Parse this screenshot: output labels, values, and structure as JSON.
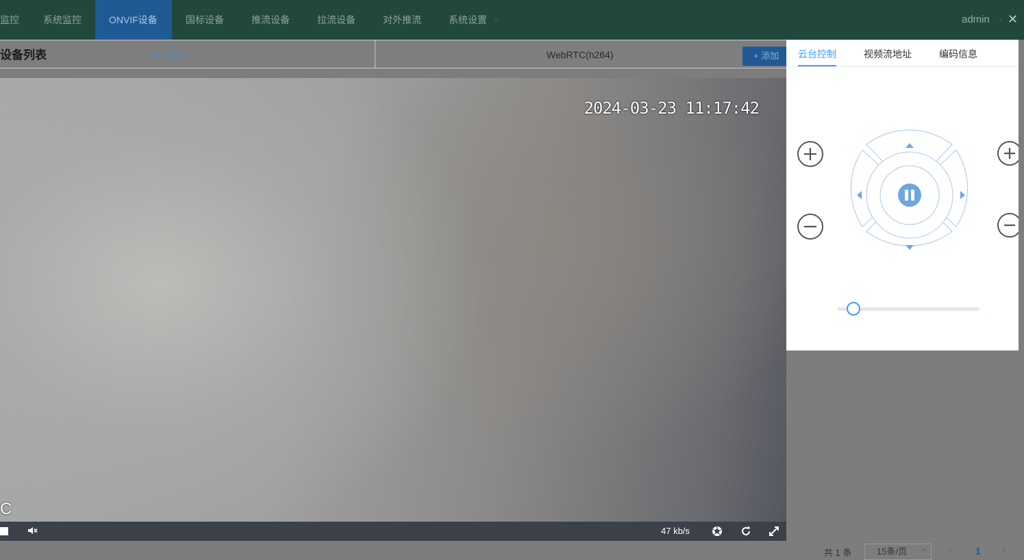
{
  "nav": {
    "items": [
      {
        "label": "监控"
      },
      {
        "label": "系统监控"
      },
      {
        "label": "ONVIF设备"
      },
      {
        "label": "国标设备"
      },
      {
        "label": "推流设备"
      },
      {
        "label": "拉流设备"
      },
      {
        "label": "对外推流"
      },
      {
        "label": "系统设置"
      }
    ],
    "active": "ONVIF设备",
    "user": "admin"
  },
  "subheader": {
    "title": "设备列表",
    "add_button": "+ 添加"
  },
  "player_tabs": [
    {
      "label": "FLV(ws)",
      "active": true
    },
    {
      "label": "WebRTC(h264)",
      "active": false
    }
  ],
  "video": {
    "osd_timestamp": "2024-03-23 11:17:42",
    "osd_corner": "C",
    "bitrate": "47 kb/s"
  },
  "panel": {
    "tabs": [
      {
        "label": "云台控制",
        "active": true
      },
      {
        "label": "视频流地址",
        "active": false
      },
      {
        "label": "编码信息",
        "active": false
      }
    ],
    "speed_level": 0.12
  },
  "pagination": {
    "total": "共 1 条",
    "page_size": "15条/页",
    "current_page": "1"
  },
  "colors": {
    "nav_bg": "#22483e",
    "nav_active_bg": "#1f5a95",
    "accent": "#409eff"
  }
}
